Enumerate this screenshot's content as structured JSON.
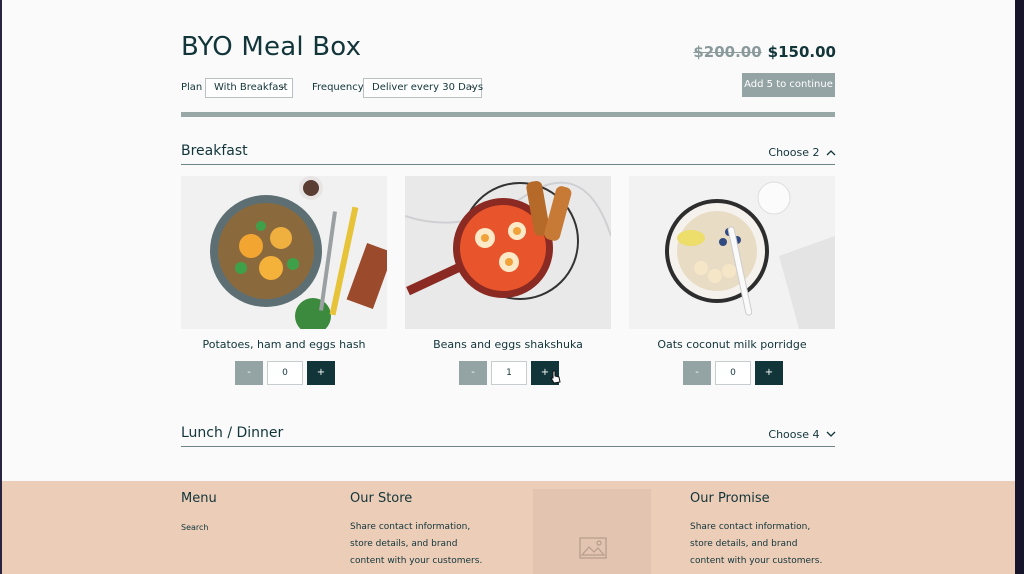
{
  "header": {
    "title": "BYO Meal Box",
    "old_price": "$200.00",
    "price": "$150.00",
    "continue_label": "Add 5 to continue",
    "progress_fraction": 1.0
  },
  "controls": {
    "plan_label": "Plan",
    "plan_value": "With Breakfast",
    "frequency_label": "Frequency",
    "frequency_value": "Deliver every 30 Days"
  },
  "sections": [
    {
      "title": "Breakfast",
      "choose": "Choose 2",
      "expanded": true,
      "items": [
        {
          "name": "Potatoes, ham and eggs hash",
          "qty": "0",
          "minus": "-",
          "plus": "+"
        },
        {
          "name": "Beans and eggs shakshuka",
          "qty": "1",
          "minus": "-",
          "plus": "+"
        },
        {
          "name": "Oats coconut milk porridge",
          "qty": "0",
          "minus": "-",
          "plus": "+"
        }
      ]
    },
    {
      "title": "Lunch / Dinner",
      "choose": "Choose 4",
      "expanded": false
    }
  ],
  "footer": {
    "menu_title": "Menu",
    "menu_links": [
      "Search"
    ],
    "store_title": "Our Store",
    "store_text": "Share contact information, store details, and brand content with your customers.",
    "promise_title": "Our Promise",
    "promise_text": "Share contact information, store details, and brand content with your customers."
  },
  "colors": {
    "primary": "#12353a",
    "muted_button": "#94a3a3",
    "footer_bg": "#eccdb8"
  }
}
